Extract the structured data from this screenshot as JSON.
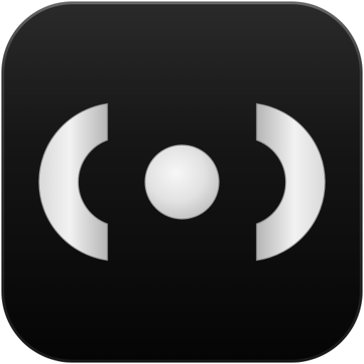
{
  "icon": {
    "name": "broadcast-signal-icon",
    "colors": {
      "tile_top": "#2a2a2a",
      "tile_bottom": "#050505",
      "tile_border": "#4a4a4a",
      "glyph_light": "#f4f4f4",
      "glyph_mid": "#d8d8d8",
      "glyph_dark": "#a9a9a9",
      "glyph_edge": "#8e8e8e"
    }
  }
}
